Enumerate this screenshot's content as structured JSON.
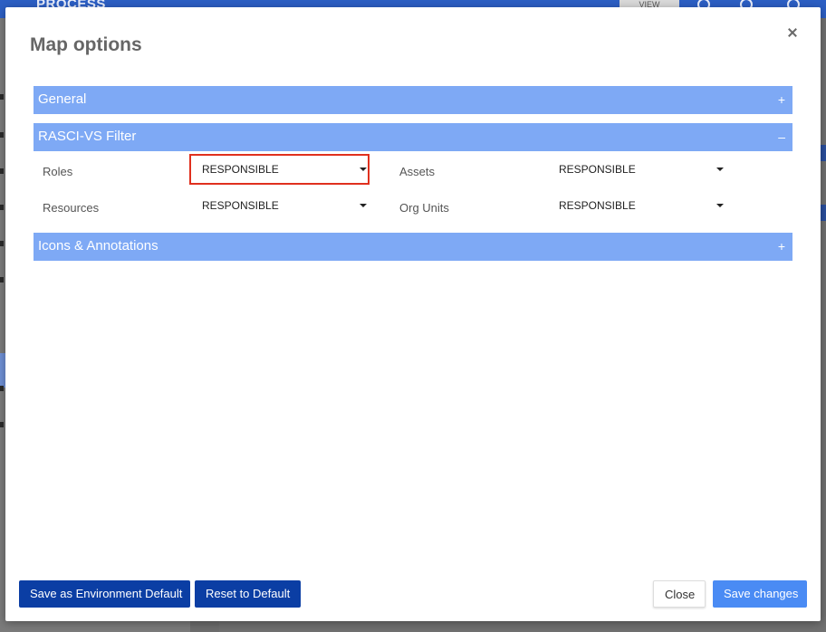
{
  "background": {
    "app_title": "PROCESS",
    "view_button": "VIEW"
  },
  "modal": {
    "title": "Map options",
    "sections": {
      "general": {
        "label": "General",
        "toggle": "+"
      },
      "rasci": {
        "label": "RASCI-VS Filter",
        "toggle": "–"
      },
      "icons": {
        "label": "Icons & Annotations",
        "toggle": "+"
      }
    },
    "fields": {
      "roles": {
        "label": "Roles",
        "value": "RESPONSIBLE"
      },
      "assets": {
        "label": "Assets",
        "value": "RESPONSIBLE"
      },
      "resources": {
        "label": "Resources",
        "value": "RESPONSIBLE"
      },
      "org_units": {
        "label": "Org Units",
        "value": "RESPONSIBLE"
      }
    },
    "buttons": {
      "save_env_default": "Save as Environment Default",
      "reset_default": "Reset to Default",
      "close": "Close",
      "save_changes": "Save changes"
    }
  },
  "colors": {
    "section_header": "#7ea9f5",
    "primary_button": "#4a8bf4",
    "dark_button": "#0b3ea4",
    "highlight": "#e0301e"
  },
  "icons": [
    "close-icon",
    "caret-down-icon",
    "plus-icon",
    "minus-icon"
  ]
}
